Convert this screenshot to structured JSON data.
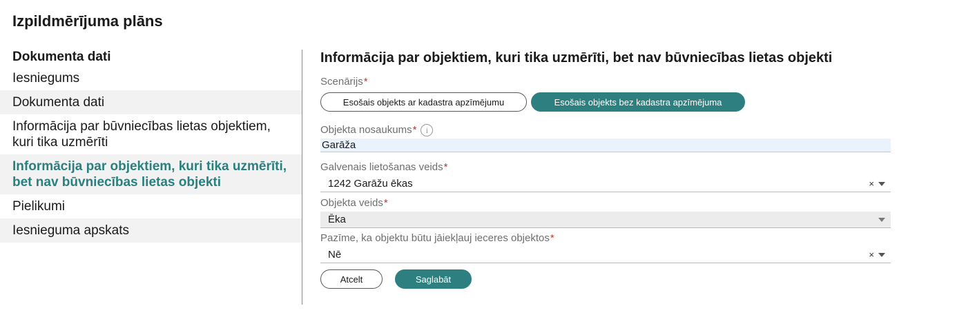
{
  "page": {
    "title": "Izpildmērījuma plāns"
  },
  "sidebar": {
    "heading": "Dokumenta dati",
    "items": [
      {
        "label": "Iesniegums"
      },
      {
        "label": "Dokumenta dati"
      },
      {
        "label": "Informācija par būvniecības lietas objektiem, kuri tika uzmērīti"
      },
      {
        "label": "Informācija par objektiem, kuri tika uzmērīti, bet nav būvniecības lietas objekti"
      },
      {
        "label": "Pielikumi"
      },
      {
        "label": "Iesnieguma apskats"
      }
    ]
  },
  "main": {
    "title": "Informācija par objektiem, kuri tika uzmērīti, bet nav būvniecības lietas objekti",
    "scenario": {
      "label": "Scenārijs",
      "required_mark": "*",
      "options": [
        {
          "label": "Esošais objekts ar kadastra apzīmējumu",
          "selected": false
        },
        {
          "label": "Esošais objekts bez kadastra apzīmējuma",
          "selected": true
        }
      ]
    },
    "object_name": {
      "label": "Objekta nosaukums",
      "required_mark": "*",
      "info_glyph": "i",
      "value": "Garāža"
    },
    "main_usage": {
      "label": "Galvenais lietošanas veids",
      "required_mark": "*",
      "value": "1242 Garāžu ēkas",
      "clear_glyph": "×"
    },
    "object_type": {
      "label": "Objekta veids",
      "required_mark": "*",
      "value": "Ēka",
      "disabled": true
    },
    "include_flag": {
      "label": "Pazīme, ka objektu būtu jāiekļauj ieceres objektos",
      "required_mark": "*",
      "value": "Nē",
      "clear_glyph": "×"
    },
    "buttons": {
      "cancel": "Atcelt",
      "save": "Saglabāt"
    }
  },
  "colors": {
    "accent": "#2e8080",
    "active_nav": "#2a7f7f",
    "required": "#c0392b",
    "input_bg": "#eaf2fc",
    "disabled_bg": "#ececec",
    "nav_shade": "#f2f2f2"
  }
}
